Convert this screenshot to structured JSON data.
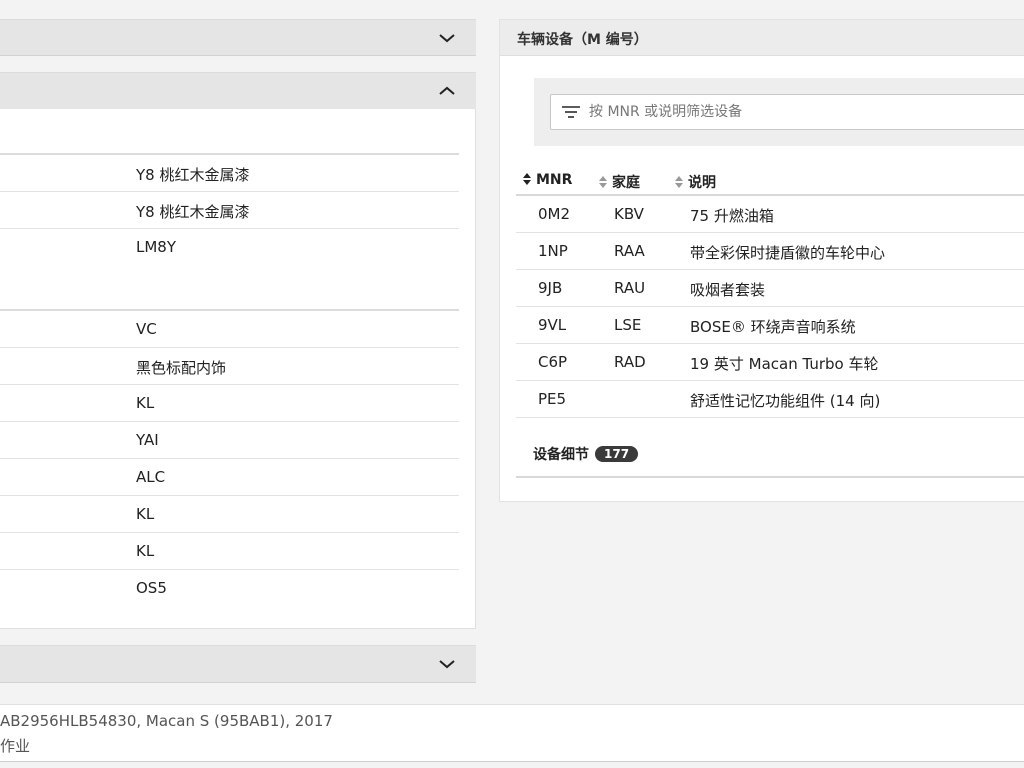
{
  "left": {
    "rows_group1": [
      {
        "value": "Y8 桃红木金属漆"
      },
      {
        "value": "Y8 桃红木金属漆"
      },
      {
        "value": "LM8Y"
      }
    ],
    "rows_group2": [
      {
        "value": "VC"
      },
      {
        "value": "黑色标配内饰"
      },
      {
        "value": "KL"
      },
      {
        "value": "YAI"
      },
      {
        "value": "ALC"
      },
      {
        "value": "KL"
      },
      {
        "value": "KL"
      },
      {
        "value": "OS5"
      }
    ]
  },
  "equipment": {
    "title": "车辆设备（M 编号）",
    "filter_placeholder": "按 MNR 或说明筛选设备",
    "filter_value": "",
    "columns": [
      "MNR",
      "家庭",
      "说明"
    ],
    "rows": [
      [
        "0M2",
        "KBV",
        "75 升燃油箱"
      ],
      [
        "1NP",
        "RAA",
        "带全彩保时捷盾徽的车轮中心"
      ],
      [
        "9JB",
        "RAU",
        "吸烟者套装"
      ],
      [
        "9VL",
        "LSE",
        "BOSE® 环绕声音响系统"
      ],
      [
        "C6P",
        "RAD",
        "19 英寸 Macan Turbo 车轮"
      ],
      [
        "PE5",
        "",
        "舒适性记忆功能组件 (14 向)"
      ]
    ],
    "details_label": "设备细节",
    "details_count": "177"
  },
  "footer": {
    "vin_line": "AB2956HLB54830, Macan S (95BAB1), 2017",
    "job_line": "作业"
  },
  "icons": {
    "accordion_collapsed": "chevron-down-icon",
    "accordion_expanded": "chevron-up-icon",
    "filter": "filter-icon",
    "sort": "sort-icon"
  }
}
